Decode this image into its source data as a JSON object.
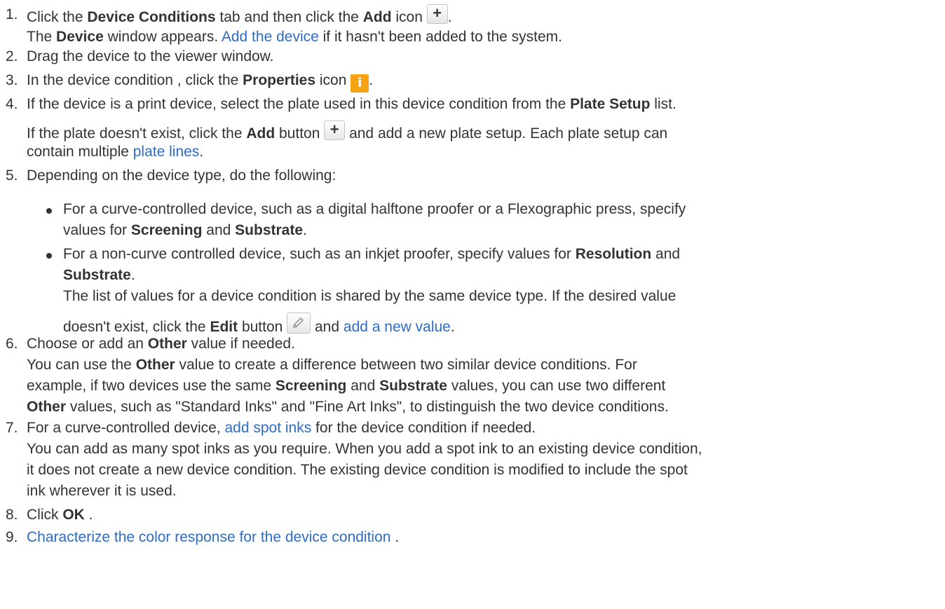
{
  "colors": {
    "text": "#333333",
    "link": "#2f6bc2",
    "icon_orange": "#f5a213"
  },
  "icons": {
    "add": "plus-icon",
    "properties": "info-icon",
    "edit": "pencil-icon"
  },
  "steps": [
    {
      "num": "1.",
      "line1": {
        "a": "Click the ",
        "b1": "Device Conditions",
        "c": " tab and then click the ",
        "b2": "Add",
        "d": " icon ",
        "e": "."
      },
      "line2": {
        "a": "The ",
        "b": "Device",
        "c": " window appears. ",
        "link": "Add the device",
        "d": " if it hasn't been added to the system."
      }
    },
    {
      "num": "2.",
      "text": "Drag the device to the viewer window."
    },
    {
      "num": "3.",
      "a": "In the device condition , click the ",
      "b": "Properties",
      "c": " icon ",
      "d": "."
    },
    {
      "num": "4.",
      "line1": {
        "a": "If the device is a print device, select the plate used in this device condition from the ",
        "b": "Plate Setup",
        "c": " list."
      },
      "line2": {
        "a": "If the plate doesn't exist, click the ",
        "b": "Add",
        "c": " button ",
        "d": " and add a new plate setup. Each plate setup can"
      },
      "line3": {
        "a": "contain multiple ",
        "link": "plate lines",
        "b": "."
      }
    },
    {
      "num": "5.",
      "text": "Depending on the device type, do the following:",
      "bullets": [
        {
          "line1": "For a curve-controlled device, such as a digital halftone proofer or a Flexographic press, specify",
          "line2": {
            "a": "values for ",
            "b1": "Screening",
            "c": " and ",
            "b2": "Substrate",
            "d": "."
          }
        },
        {
          "line1": {
            "a": "For a non-curve controlled device, such as an inkjet proofer, specify values for ",
            "b": "Resolution",
            "c": " and"
          },
          "line2": {
            "b": "Substrate",
            "c": "."
          },
          "line3": "The list of values for a device condition is shared by the same device type. If the desired value",
          "line4": {
            "a": "doesn't exist, click the ",
            "b": "Edit",
            "c": " button ",
            "d": " and ",
            "link": "add a new value",
            "e": "."
          }
        }
      ]
    },
    {
      "num": "6.",
      "line1": {
        "a": "Choose or add an ",
        "b": "Other",
        "c": " value if needed."
      },
      "line2": {
        "a": "You can use the ",
        "b": "Other",
        "c": " value to create a difference between two similar device conditions. For"
      },
      "line3": {
        "a": "example, if two devices use the same ",
        "b1": "Screening",
        "c": " and ",
        "b2": "Substrate",
        "d": " values, you can use two different"
      },
      "line4": {
        "b": "Other",
        "c": " values, such as \"Standard Inks\" and \"Fine Art Inks\", to distinguish the two device conditions."
      }
    },
    {
      "num": "7.",
      "line1": {
        "a": "For a curve-controlled device, ",
        "link": "add spot inks",
        "b": " for the device condition if needed."
      },
      "line2": "You can add as many spot inks as you require. When you add a spot ink to an existing device condition,",
      "line3": "it does not create a new device condition. The existing device condition is modified to include the spot",
      "line4": "ink wherever it is used."
    },
    {
      "num": "8.",
      "a": "Click ",
      "b": "OK",
      "c": " ."
    },
    {
      "num": "9.",
      "link": "Characterize the color response for the device condition",
      "a": " ."
    }
  ]
}
